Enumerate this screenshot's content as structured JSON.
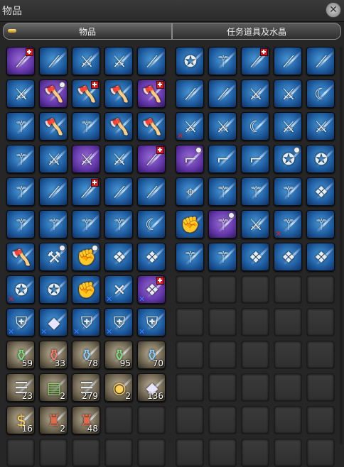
{
  "window": {
    "title": "物品",
    "close_glyph": "✕"
  },
  "tabs": [
    {
      "label": "物品",
      "active": true
    },
    {
      "label": "任务道具及水晶",
      "active": false
    }
  ],
  "left_grid": [
    {
      "icon": "lance-icon",
      "color": "purple",
      "mark": "red-cross"
    },
    {
      "icon": "lance-icon",
      "color": "blue"
    },
    {
      "icon": "sword-icon",
      "color": "blue"
    },
    {
      "icon": "sword-icon",
      "color": "blue"
    },
    {
      "icon": "lance-icon",
      "color": "blue"
    },
    {
      "icon": "sword-icon",
      "color": "blue"
    },
    {
      "icon": "axe-icon",
      "color": "purple",
      "mark": "dot"
    },
    {
      "icon": "axe-icon",
      "color": "blue",
      "mark": "red-cross"
    },
    {
      "icon": "axe-icon",
      "color": "blue"
    },
    {
      "icon": "axe-icon",
      "color": "purple",
      "mark": "red-cross"
    },
    {
      "icon": "staff-icon",
      "color": "blue"
    },
    {
      "icon": "axe-icon",
      "color": "blue"
    },
    {
      "icon": "staff-icon",
      "color": "blue"
    },
    {
      "icon": "axe-icon",
      "color": "blue"
    },
    {
      "icon": "axe-icon",
      "color": "blue"
    },
    {
      "icon": "staff-icon",
      "color": "blue"
    },
    {
      "icon": "sword-icon",
      "color": "blue"
    },
    {
      "icon": "sword-icon",
      "color": "purple"
    },
    {
      "icon": "sword-icon",
      "color": "blue"
    },
    {
      "icon": "lance-icon",
      "color": "purple",
      "mark": "red-cross"
    },
    {
      "icon": "staff-icon",
      "color": "blue"
    },
    {
      "icon": "lance-icon",
      "color": "blue"
    },
    {
      "icon": "lance-icon",
      "color": "blue",
      "mark": "red-cross"
    },
    {
      "icon": "lance-icon",
      "color": "blue"
    },
    {
      "icon": "lance-icon",
      "color": "blue"
    },
    {
      "icon": "staff-icon",
      "color": "blue"
    },
    {
      "icon": "staff-icon",
      "color": "blue"
    },
    {
      "icon": "staff-icon",
      "color": "blue"
    },
    {
      "icon": "staff-icon",
      "color": "blue"
    },
    {
      "icon": "scythe-icon",
      "color": "blue"
    },
    {
      "icon": "axe-icon",
      "color": "blue"
    },
    {
      "icon": "hammer-icon",
      "color": "blue",
      "mark": "dot"
    },
    {
      "icon": "gauntlet-icon",
      "color": "blue",
      "mark": "dot"
    },
    {
      "icon": "book-icon",
      "color": "blue"
    },
    {
      "icon": "book-icon",
      "color": "blue"
    },
    {
      "icon": "chakram-icon",
      "color": "blue",
      "mark": "x-red"
    },
    {
      "icon": "chakram-icon",
      "color": "blue"
    },
    {
      "icon": "gauntlet-icon",
      "color": "blue"
    },
    {
      "icon": "dagger-icon",
      "color": "blue",
      "mark": "x-blue"
    },
    {
      "icon": "book-icon",
      "color": "purple",
      "mark": "red-cross",
      "mark2": "x-blue"
    },
    {
      "icon": "shield-icon",
      "color": "blue",
      "mark": "x-blue"
    },
    {
      "icon": "crystal-icon",
      "color": "blue",
      "mark": "x-blue"
    },
    {
      "icon": "shield-icon",
      "color": "blue",
      "mark": "x-blue"
    },
    {
      "icon": "shield-icon",
      "color": "blue",
      "mark": "x-blue"
    },
    {
      "icon": "shield-icon",
      "color": "blue",
      "mark": "x-blue"
    },
    {
      "icon": "potion-green-icon",
      "color": "gold",
      "qty": "59"
    },
    {
      "icon": "potion-red-icon",
      "color": "gold",
      "qty": "33"
    },
    {
      "icon": "potion-blue-icon",
      "color": "gold",
      "qty": "78"
    },
    {
      "icon": "potion-green-icon",
      "color": "gold",
      "qty": "95"
    },
    {
      "icon": "potion-blue-icon",
      "color": "gold",
      "qty": "70"
    },
    {
      "icon": "scroll-icon",
      "color": "gold",
      "qty": "23"
    },
    {
      "icon": "scroll-green-icon",
      "color": "gold",
      "qty": "2"
    },
    {
      "icon": "scroll-icon",
      "color": "gold",
      "qty": "279"
    },
    {
      "icon": "food-icon",
      "color": "gold",
      "qty": "2"
    },
    {
      "icon": "crystal-icon",
      "color": "gold",
      "qty": "136"
    },
    {
      "icon": "money-bag-icon",
      "color": "gold",
      "qty": "16"
    },
    {
      "icon": "bottle-icon",
      "color": "gold",
      "qty": "2"
    },
    {
      "icon": "bottle-icon",
      "color": "gold",
      "qty": "48"
    },
    {
      "empty": true
    },
    {
      "empty": true
    },
    {
      "empty": true
    },
    {
      "empty": true
    },
    {
      "empty": true
    },
    {
      "empty": true
    },
    {
      "empty": true
    }
  ],
  "right_grid": [
    {
      "icon": "chakram-icon",
      "color": "blue"
    },
    {
      "icon": "staff-icon",
      "color": "blue"
    },
    {
      "icon": "lance-icon",
      "color": "blue",
      "mark": "red-cross"
    },
    {
      "icon": "lance-icon",
      "color": "blue"
    },
    {
      "icon": "lance-icon",
      "color": "blue"
    },
    {
      "icon": "lance-icon",
      "color": "blue"
    },
    {
      "icon": "lance-icon",
      "color": "blue"
    },
    {
      "icon": "sword-icon",
      "color": "blue"
    },
    {
      "icon": "sword-icon",
      "color": "blue"
    },
    {
      "icon": "scythe-icon",
      "color": "blue"
    },
    {
      "icon": "sword-icon",
      "color": "blue",
      "mark": "x-red"
    },
    {
      "icon": "sword-icon",
      "color": "blue"
    },
    {
      "icon": "scythe-icon",
      "color": "blue"
    },
    {
      "icon": "sword-icon",
      "color": "blue"
    },
    {
      "icon": "sword-icon",
      "color": "blue"
    },
    {
      "icon": "gun-icon",
      "color": "purple",
      "mark": "dot"
    },
    {
      "icon": "gun-icon",
      "color": "blue"
    },
    {
      "icon": "gun-icon",
      "color": "blue"
    },
    {
      "icon": "chakram-icon",
      "color": "blue",
      "mark": "dot"
    },
    {
      "icon": "chakram-icon",
      "color": "blue"
    },
    {
      "icon": "crosshair-icon",
      "color": "blue"
    },
    {
      "icon": "staff-icon",
      "color": "blue"
    },
    {
      "icon": "staff-icon",
      "color": "blue"
    },
    {
      "icon": "staff-icon",
      "color": "blue"
    },
    {
      "icon": "book-icon",
      "color": "blue"
    },
    {
      "icon": "gauntlet-icon",
      "color": "blue"
    },
    {
      "icon": "staff-icon",
      "color": "purple",
      "mark": "dot"
    },
    {
      "icon": "sword-icon",
      "color": "blue"
    },
    {
      "icon": "staff-icon",
      "color": "blue",
      "mark": "x-red"
    },
    {
      "icon": "staff-icon",
      "color": "blue"
    },
    {
      "icon": "staff-icon",
      "color": "blue"
    },
    {
      "icon": "staff-icon",
      "color": "blue"
    },
    {
      "icon": "book-icon",
      "color": "blue"
    },
    {
      "icon": "book-icon",
      "color": "blue"
    },
    {
      "icon": "book-icon",
      "color": "blue"
    },
    {
      "empty": true
    },
    {
      "empty": true
    },
    {
      "empty": true
    },
    {
      "empty": true
    },
    {
      "empty": true
    },
    {
      "empty": true
    },
    {
      "empty": true
    },
    {
      "empty": true
    },
    {
      "empty": true
    },
    {
      "empty": true
    },
    {
      "empty": true
    },
    {
      "empty": true
    },
    {
      "empty": true
    },
    {
      "empty": true
    },
    {
      "empty": true
    },
    {
      "empty": true
    },
    {
      "empty": true
    },
    {
      "empty": true
    },
    {
      "empty": true
    },
    {
      "empty": true
    },
    {
      "empty": true
    },
    {
      "empty": true
    },
    {
      "empty": true
    },
    {
      "empty": true
    },
    {
      "empty": true
    },
    {
      "empty": true
    },
    {
      "empty": true
    },
    {
      "empty": true
    },
    {
      "empty": true
    },
    {
      "empty": true
    }
  ]
}
